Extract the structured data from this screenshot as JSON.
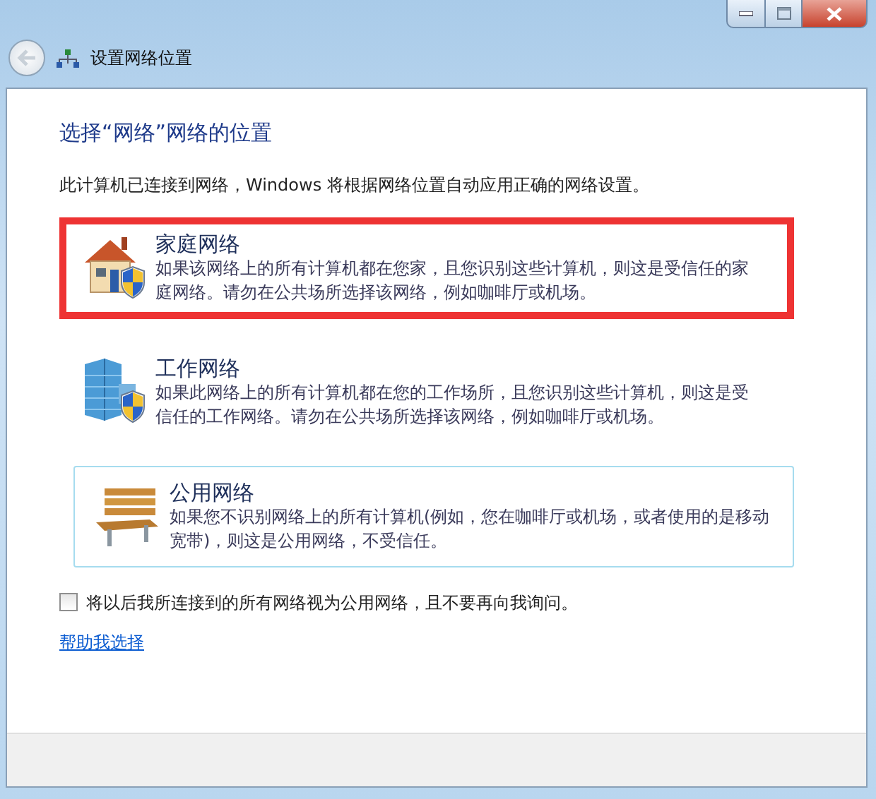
{
  "window": {
    "title": "设置网络位置"
  },
  "heading": "选择“网络”网络的位置",
  "intro": "此计算机已连接到网络，Windows 将根据网络位置自动应用正确的网络设置。",
  "locations": [
    {
      "kind": "home",
      "title": "家庭网络",
      "description": "如果该网络上的所有计算机都在您家，且您识别这些计算机，则这是受信任的家庭网络。请勿在公共场所选择该网络，例如咖啡厅或机场。",
      "highlighted": true,
      "hovered": false
    },
    {
      "kind": "work",
      "title": "工作网络",
      "description": "如果此网络上的所有计算机都在您的工作场所，且您识别这些计算机，则这是受信任的工作网络。请勿在公共场所选择该网络，例如咖啡厅或机场。",
      "highlighted": false,
      "hovered": false
    },
    {
      "kind": "public",
      "title": "公用网络",
      "description": "如果您不识别网络上的所有计算机(例如，您在咖啡厅或机场，或者使用的是移动宽带)，则这是公用网络，不受信任。",
      "highlighted": false,
      "hovered": true
    }
  ],
  "treat_all_public": {
    "label": "将以后我所连接到的所有网络视为公用网络，且不要再向我询问。",
    "checked": false
  },
  "help_link": "帮助我选择"
}
